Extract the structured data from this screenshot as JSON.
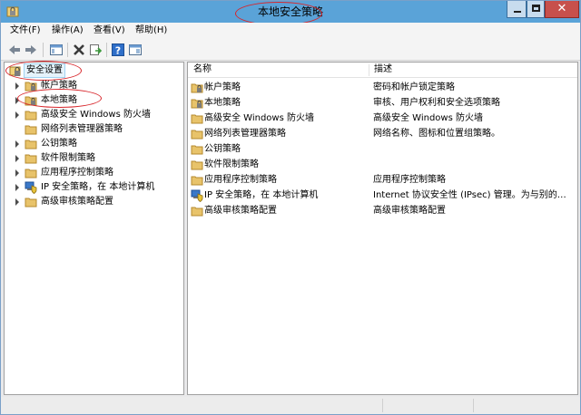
{
  "window": {
    "title": "本地安全策略",
    "controls": {
      "close_glyph": "✕"
    }
  },
  "menu": {
    "items": [
      {
        "label": "文件(F)"
      },
      {
        "label": "操作(A)"
      },
      {
        "label": "查看(V)"
      },
      {
        "label": "帮助(H)"
      }
    ]
  },
  "toolbar": {
    "buttons": [
      "back-icon",
      "forward-icon",
      "console-tree-icon",
      "delete-icon",
      "export-list-icon",
      "help-icon",
      "properties-icon"
    ]
  },
  "tree": {
    "root": {
      "label": "安全设置",
      "icon": "security-settings-icon"
    },
    "items": [
      {
        "label": "帐户策略",
        "icon": "folder-lock-icon"
      },
      {
        "label": "本地策略",
        "icon": "folder-lock-icon"
      },
      {
        "label": "高级安全 Windows 防火墙",
        "icon": "folder-icon"
      },
      {
        "label": "网络列表管理器策略",
        "icon": "folder-icon"
      },
      {
        "label": "公钥策略",
        "icon": "folder-icon"
      },
      {
        "label": "软件限制策略",
        "icon": "folder-icon"
      },
      {
        "label": "应用程序控制策略",
        "icon": "folder-icon"
      },
      {
        "label": "IP 安全策略，在 本地计算机",
        "icon": "ip-security-icon"
      },
      {
        "label": "高级审核策略配置",
        "icon": "folder-icon"
      }
    ]
  },
  "list": {
    "columns": {
      "name": "名称",
      "description": "描述"
    },
    "rows": [
      {
        "name": "帐户策略",
        "description": "密码和帐户锁定策略",
        "icon": "folder-lock-icon"
      },
      {
        "name": "本地策略",
        "description": "审核、用户权利和安全选项策略",
        "icon": "folder-lock-icon"
      },
      {
        "name": "高级安全 Windows 防火墙",
        "description": "高级安全 Windows 防火墙",
        "icon": "folder-icon"
      },
      {
        "name": "网络列表管理器策略",
        "description": "网络名称、图标和位置组策略。",
        "icon": "folder-icon"
      },
      {
        "name": "公钥策略",
        "description": "",
        "icon": "folder-icon"
      },
      {
        "name": "软件限制策略",
        "description": "",
        "icon": "folder-icon"
      },
      {
        "name": "应用程序控制策略",
        "description": "应用程序控制策略",
        "icon": "folder-icon"
      },
      {
        "name": "IP 安全策略，在 本地计算机",
        "description": "Internet 协议安全性 (IPsec) 管理。为与别的…",
        "icon": "ip-security-icon"
      },
      {
        "name": "高级审核策略配置",
        "description": "高级审核策略配置",
        "icon": "folder-icon"
      }
    ]
  },
  "colors": {
    "titlebar": "#5aa3d8",
    "folder": "#e8c36a",
    "annotation_red": "#d8262b"
  }
}
